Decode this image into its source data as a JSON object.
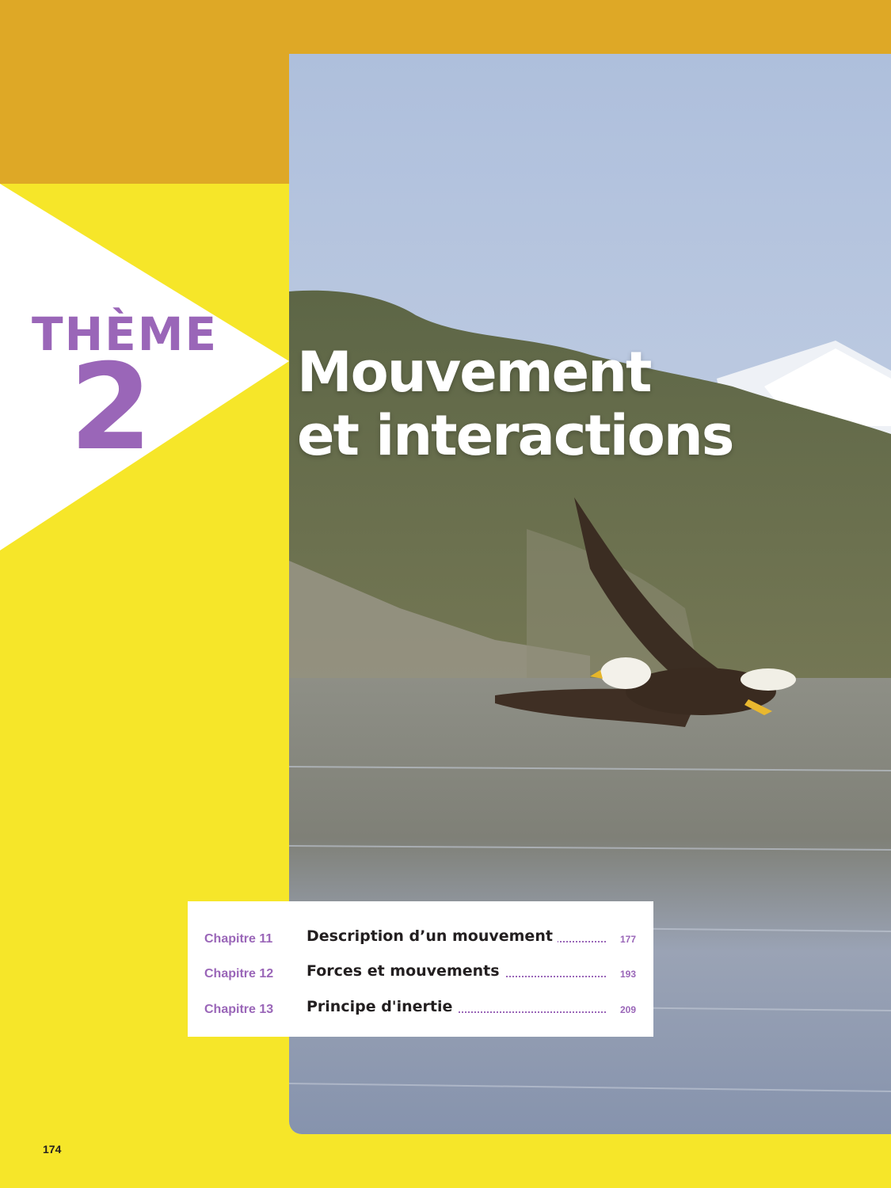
{
  "theme": {
    "label": "THÈME",
    "number": "2"
  },
  "title": {
    "line1": "Mouvement",
    "line2": "et interactions"
  },
  "toc": [
    {
      "chapter": "Chapitre 11",
      "title": "Description d’un mouvement",
      "page": "177"
    },
    {
      "chapter": "Chapitre 12",
      "title": "Forces et mouvements",
      "page": "193"
    },
    {
      "chapter": "Chapitre 13",
      "title": "Principe d'inertie",
      "page": "209"
    }
  ],
  "page_number": "174",
  "colors": {
    "orange": "#dea826",
    "yellow": "#f6e629",
    "purple": "#9a66b8",
    "white": "#ffffff"
  },
  "image": {
    "subject": "bald-eagle-over-lake-photo"
  }
}
